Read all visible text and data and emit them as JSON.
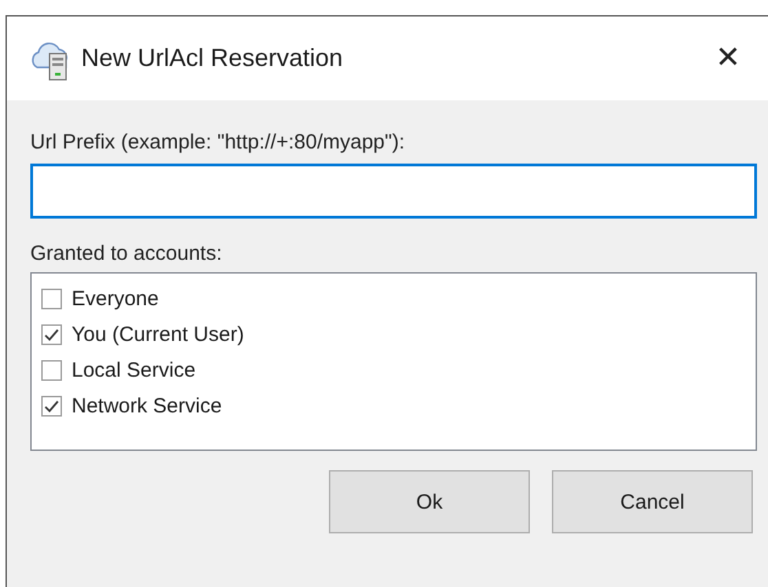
{
  "window": {
    "title": "New UrlAcl Reservation",
    "close": "✕"
  },
  "url_prefix": {
    "label": "Url Prefix (example: \"http://+:80/myapp\"):",
    "focused": true
  },
  "accounts": {
    "label": "Granted to accounts:",
    "items": [
      {
        "label": "Everyone",
        "checked": false
      },
      {
        "label": "You (Current User)",
        "checked": true
      },
      {
        "label": "Local Service",
        "checked": false
      },
      {
        "label": "Network Service",
        "checked": true
      }
    ]
  },
  "buttons": [
    "Ok",
    "Cancel"
  ]
}
